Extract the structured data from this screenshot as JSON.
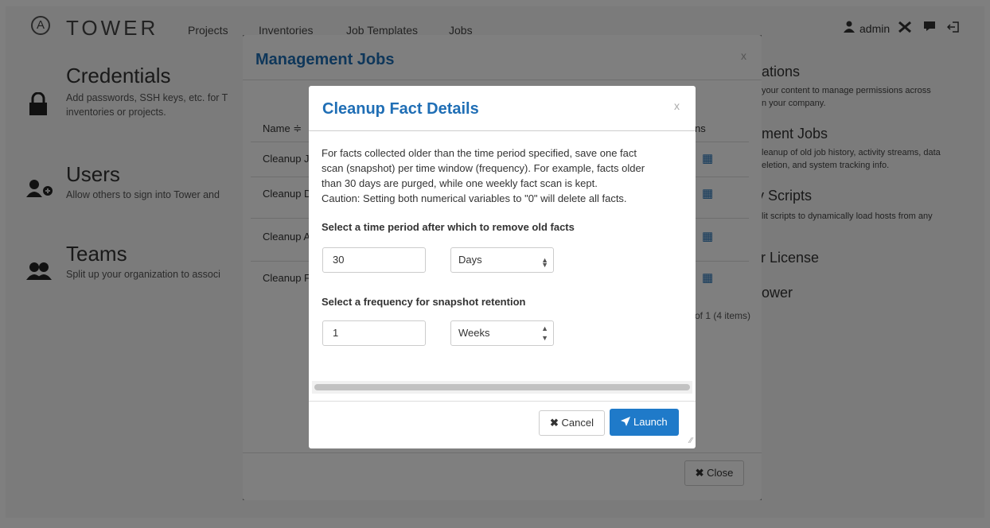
{
  "navbar": {
    "logo_letter": "A",
    "brand": "TOWER",
    "links": [
      "Projects",
      "Inventories",
      "Job Templates",
      "Jobs"
    ],
    "user": "admin",
    "icons": [
      "user-icon",
      "wrench-icon",
      "chat-icon",
      "logout-icon"
    ]
  },
  "background_sections": {
    "credentials": {
      "title": "Credentials",
      "desc_line1": "Add passwords, SSH keys, etc. for T",
      "desc_line2": "inventories or projects."
    },
    "users": {
      "title": "Users",
      "desc": "Allow others to sign into Tower and"
    },
    "teams": {
      "title": "Teams",
      "desc": "Split up your organization to associ"
    },
    "right": [
      {
        "title": "ations",
        "desc1": "your content to manage permissions across",
        "desc2": "n your company."
      },
      {
        "title": "ment Jobs",
        "desc1": "leanup of old job history, activity streams, data",
        "desc2": "eletion, and system tracking info."
      },
      {
        "title": "y Scripts",
        "desc1": "lit scripts to dynamically load hosts from any",
        "desc2": ""
      },
      {
        "title": "ır License",
        "desc1": "",
        "desc2": ""
      },
      {
        "title": "ower",
        "desc1": "",
        "desc2": ""
      }
    ]
  },
  "management_jobs_modal": {
    "title": "Management Jobs",
    "close_x": "x",
    "col_name": "Name ≑",
    "col_actions": "ns",
    "rows": [
      "Cleanup J",
      "Cleanup D",
      "Cleanup A",
      "Cleanup F"
    ],
    "paging": "of 1 (4 items)",
    "close_button": "Close"
  },
  "cleanup_dialog": {
    "title": "Cleanup Fact Details",
    "close_x": "x",
    "description_lines": [
      "For facts collected older than the time period specified, save one fact",
      "scan (snapshot) per time window (frequency). For example, facts older",
      "than 30 days are purged, while one weekly fact scan is kept.",
      "Caution: Setting both numerical variables to \"0\" will delete all facts."
    ],
    "period_label": "Select a time period after which to remove old facts",
    "period_value": "30",
    "period_unit": "Days",
    "frequency_label": "Select a frequency for snapshot retention",
    "frequency_value": "1",
    "frequency_unit": "Weeks",
    "cancel_label": "Cancel",
    "launch_label": "Launch"
  },
  "colors": {
    "accent": "#1f6eb5",
    "launch_bg": "#1f7ac9"
  }
}
